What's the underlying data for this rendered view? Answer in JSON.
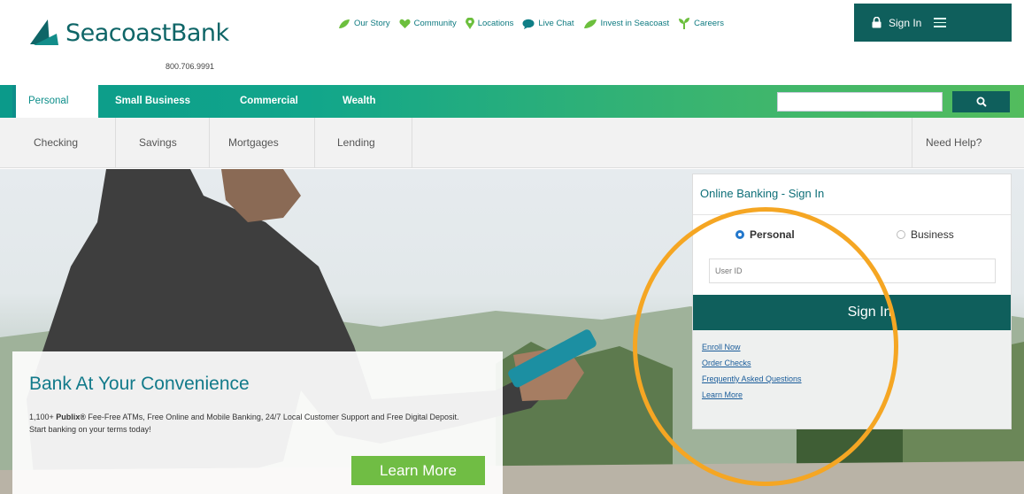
{
  "header": {
    "brand": "SeacoastBank",
    "phone": "800.706.9991",
    "utility_links": [
      {
        "label": "Our Story",
        "icon": "leaf-icon"
      },
      {
        "label": "Community",
        "icon": "heart-icon"
      },
      {
        "label": "Locations",
        "icon": "location-pin-icon"
      },
      {
        "label": "Live Chat",
        "icon": "chat-bubble-icon"
      },
      {
        "label": "Invest in Seacoast",
        "icon": "leaf-icon"
      },
      {
        "label": "Careers",
        "icon": "sprout-icon"
      }
    ],
    "sign_in_label": "Sign In"
  },
  "main_nav": {
    "tabs": [
      "Personal",
      "Small Business",
      "Commercial",
      "Wealth"
    ],
    "active": "Personal",
    "search_placeholder": ""
  },
  "sub_nav": {
    "items": [
      "Checking",
      "Savings",
      "Mortgages",
      "Lending"
    ],
    "help": "Need Help?"
  },
  "promo": {
    "title": "Bank At Your Convenience",
    "body_prefix": "1,100+ ",
    "body_brand": "Publix®",
    "body_rest": " Fee-Free ATMs, Free Online and Mobile Banking, 24/7 Local Customer Support and Free Digital Deposit. Start banking on your terms today!",
    "button": "Learn More"
  },
  "signin_panel": {
    "title": "Online Banking - Sign In",
    "options": [
      "Personal",
      "Business"
    ],
    "selected": "Personal",
    "user_id_placeholder": "User ID",
    "button": "Sign In",
    "links": [
      "Enroll Now",
      "Order Checks",
      "Frequently Asked Questions",
      "Learn More"
    ]
  },
  "colors": {
    "brand_teal": "#0f5f5c",
    "nav_green": "#3bb56f",
    "highlight": "#f5a623",
    "cta_green": "#70bd44"
  }
}
